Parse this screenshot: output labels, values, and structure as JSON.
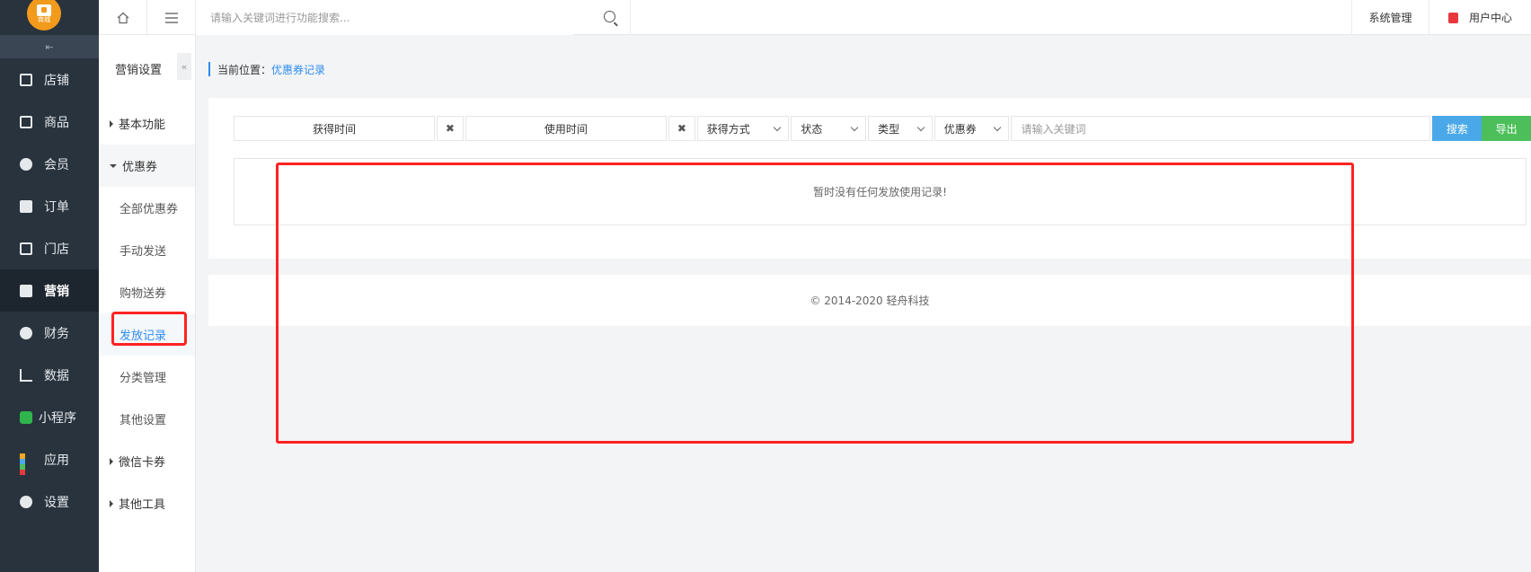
{
  "logo": {
    "text": "商城"
  },
  "sidebar": {
    "collapse_icon": "⇤",
    "items": [
      {
        "label": "店铺",
        "icon": "store-icon"
      },
      {
        "label": "商品",
        "icon": "goods-icon"
      },
      {
        "label": "会员",
        "icon": "member-icon"
      },
      {
        "label": "订单",
        "icon": "order-icon"
      },
      {
        "label": "门店",
        "icon": "shop-icon"
      },
      {
        "label": "营销",
        "icon": "gift-icon",
        "active": true
      },
      {
        "label": "财务",
        "icon": "money-bag-icon"
      },
      {
        "label": "数据",
        "icon": "bar-chart-icon"
      },
      {
        "label": "小程序",
        "icon": "miniprogram-icon"
      },
      {
        "label": "应用",
        "icon": "apps-icon"
      },
      {
        "label": "设置",
        "icon": "gear-icon"
      }
    ]
  },
  "submenu": {
    "title": "营销设置",
    "toggle": "«",
    "items": [
      {
        "label": "基本功能",
        "type": "group"
      },
      {
        "label": "优惠券",
        "type": "group-open"
      },
      {
        "label": "全部优惠券",
        "type": "child"
      },
      {
        "label": "手动发送",
        "type": "child"
      },
      {
        "label": "购物送券",
        "type": "child"
      },
      {
        "label": "发放记录",
        "type": "child-current"
      },
      {
        "label": "分类管理",
        "type": "child"
      },
      {
        "label": "其他设置",
        "type": "child"
      },
      {
        "label": "微信卡券",
        "type": "group"
      },
      {
        "label": "其他工具",
        "type": "group"
      }
    ]
  },
  "topbar": {
    "search_placeholder": "请输入关键词进行功能搜索...",
    "system_label": "系统管理",
    "user_center_label": "用户中心"
  },
  "breadcrumb": {
    "prefix": "当前位置：",
    "current": "优惠券记录"
  },
  "filters": {
    "obtain_time": "获得时间",
    "use_time": "使用时间",
    "clear_symbol": "✖",
    "obtain_method": "获得方式",
    "status": "状态",
    "type": "类型",
    "coupon": "优惠券",
    "keyword_placeholder": "请输入关键词",
    "search_button": "搜索",
    "export_button": "导出"
  },
  "empty_message": "暂时没有任何发放使用记录!",
  "footer": {
    "copyright": "© 2014-2020 轻舟科技"
  },
  "colors": {
    "accent": "#2d8cf0",
    "sidebar_bg": "#28333e",
    "search_btn": "#4aa8e8",
    "export_btn": "#4cbf5a",
    "annotation": "#ff2222"
  }
}
